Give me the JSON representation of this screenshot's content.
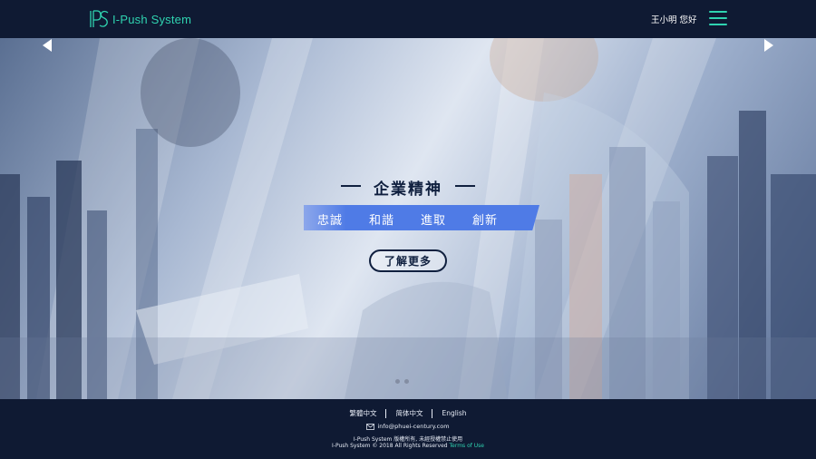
{
  "header": {
    "logo_text": "I-Push System",
    "greeting": "王小明 您好"
  },
  "hero": {
    "motto_title": "企業精神",
    "values": [
      "忠誠",
      "和諧",
      "進取",
      "創新"
    ],
    "more_label": "了解更多",
    "slides_count": 2
  },
  "footer": {
    "languages": [
      "繁體中文",
      "简体中文",
      "English"
    ],
    "email": "info@phuei-century.com",
    "rights": "I-Push System 版權所有, 未經授權禁止使用",
    "copyright": "I-Push System © 2018 All Rights  Reserved",
    "terms_label": "Terms of Use"
  },
  "colors": {
    "navy": "#0f1a33",
    "accent": "#2fd3b0",
    "band": "#4f7be6"
  }
}
